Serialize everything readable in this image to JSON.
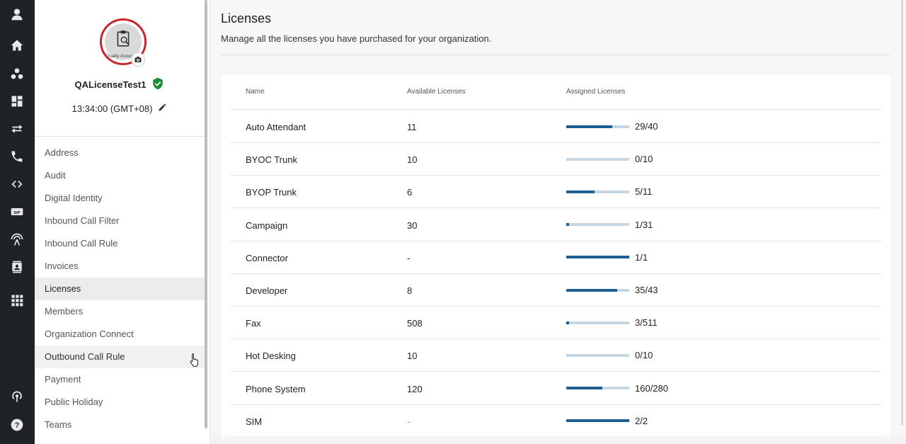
{
  "rail": {
    "icons": [
      "user-icon",
      "home-icon",
      "people-icon",
      "dashboard-icon",
      "transfer-icon",
      "phone-icon",
      "code-icon",
      "sip-icon",
      "antenna-icon",
      "contacts-icon",
      "apps-icon",
      "broadcast-icon",
      "help-icon"
    ],
    "sip_label": "SIP"
  },
  "sidebar": {
    "org_name": "QALicenseTest1",
    "avatar_caption": "Quality Assurance",
    "time": "13:34:00 (GMT+08)",
    "items": [
      {
        "label": "Address"
      },
      {
        "label": "Audit"
      },
      {
        "label": "Digital Identity"
      },
      {
        "label": "Inbound Call Filter"
      },
      {
        "label": "Inbound Call Rule"
      },
      {
        "label": "Invoices"
      },
      {
        "label": "Licenses"
      },
      {
        "label": "Members"
      },
      {
        "label": "Organization Connect"
      },
      {
        "label": "Outbound Call Rule"
      },
      {
        "label": "Payment"
      },
      {
        "label": "Public Holiday"
      },
      {
        "label": "Teams"
      }
    ],
    "active_item": "Licenses",
    "hover_item": "Outbound Call Rule"
  },
  "main": {
    "title": "Licenses",
    "subtitle": "Manage all the licenses you have purchased for your organization.",
    "columns": {
      "name": "Name",
      "available": "Available Licenses",
      "assigned": "Assigned Licenses"
    },
    "rows": [
      {
        "name": "Auto Attendant",
        "available": "11",
        "assigned": "29/40",
        "fraction": 0.725
      },
      {
        "name": "BYOC Trunk",
        "available": "10",
        "assigned": "0/10",
        "fraction": 0
      },
      {
        "name": "BYOP Trunk",
        "available": "6",
        "assigned": "5/11",
        "fraction": 0.4545
      },
      {
        "name": "Campaign",
        "available": "30",
        "assigned": "1/31",
        "fraction": 0.0323
      },
      {
        "name": "Connector",
        "available": "-",
        "assigned": "1/1",
        "fraction": 1
      },
      {
        "name": "Developer",
        "available": "8",
        "assigned": "35/43",
        "fraction": 0.814
      },
      {
        "name": "Fax",
        "available": "508",
        "assigned": "3/511",
        "fraction": 0.0059
      },
      {
        "name": "Hot Desking",
        "available": "10",
        "assigned": "0/10",
        "fraction": 0
      },
      {
        "name": "Phone System",
        "available": "120",
        "assigned": "160/280",
        "fraction": 0.5714
      },
      {
        "name": "SIM",
        "available": "-",
        "assigned": "2/2",
        "fraction": 1
      }
    ]
  },
  "colors": {
    "rail_bg": "#1f2327",
    "accent": "#1e5f93",
    "track": "#c6d7e3",
    "brand_red": "#c9252c",
    "shield_green": "#1e8a3c"
  }
}
